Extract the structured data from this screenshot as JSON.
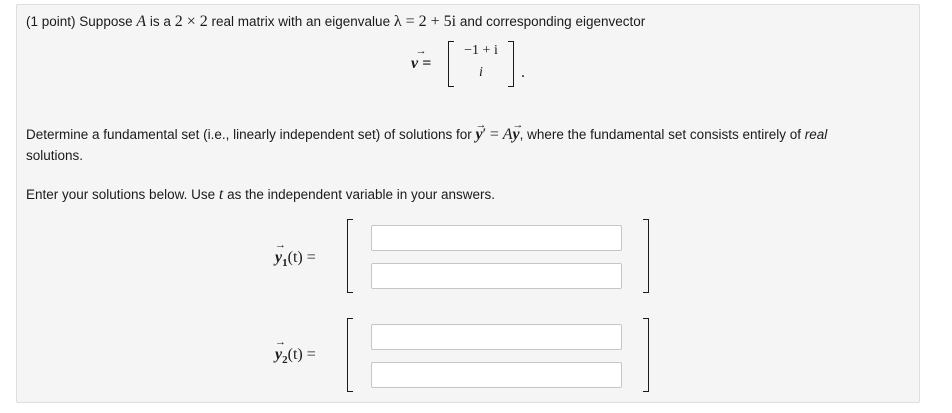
{
  "problem": {
    "points": "(1 point)",
    "intro_1": "Suppose",
    "matrix_A": "A",
    "intro_2": "is a",
    "dims": "2 × 2",
    "intro_3": "real matrix with an eigenvalue",
    "lambda_expr": "λ = 2 + 5i",
    "intro_4": "and corresponding eigenvector",
    "v_lhs": "v =",
    "v_top": "−1 + i",
    "v_bottom": "i",
    "v_period": ".",
    "det_1": "Determine a fundamental set (i.e., linearly independent set) of solutions for",
    "ode_y1": "y",
    "ode_prime": "′",
    "ode_eq": "=",
    "ode_A": "A",
    "ode_y2": "y",
    "det_2": ", where the fundamental set consists entirely of",
    "det_real": "real",
    "det_3": "solutions.",
    "enter_1": "Enter your solutions below. Use",
    "enter_t": "t",
    "enter_2": "as the independent variable in your answers."
  },
  "answers": [
    {
      "label_y": "y",
      "label_sub": "1",
      "label_rest": "(t) =",
      "top_value": "",
      "bottom_value": ""
    },
    {
      "label_y": "y",
      "label_sub": "2",
      "label_rest": "(t) =",
      "top_value": "",
      "bottom_value": ""
    }
  ]
}
